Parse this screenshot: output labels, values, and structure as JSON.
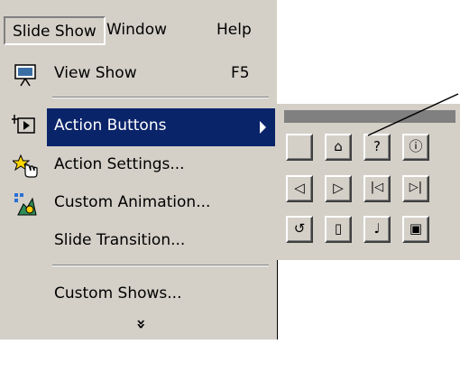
{
  "menubar": {
    "items": [
      {
        "label": "Slide Show",
        "active": true
      },
      {
        "label": "Window",
        "active": false
      },
      {
        "label": "Help",
        "active": false
      }
    ]
  },
  "menu": {
    "items": [
      {
        "label": "View Show",
        "shortcut": "F5",
        "icon": "projector-screen-icon"
      },
      {
        "label": "Action Buttons",
        "icon": "action-button-icon",
        "submenu": true,
        "highlighted": true
      },
      {
        "label": "Action Settings...",
        "icon": "star-hand-icon"
      },
      {
        "label": "Custom Animation...",
        "icon": "animation-icon"
      },
      {
        "label": "Slide Transition..."
      },
      {
        "label": "Custom Shows..."
      }
    ],
    "expand_glyph": "»"
  },
  "action_buttons": {
    "rows": [
      [
        {
          "name": "custom",
          "glyph": ""
        },
        {
          "name": "home",
          "glyph": "⌂"
        },
        {
          "name": "help",
          "glyph": "?"
        },
        {
          "name": "information",
          "glyph": "ⓘ"
        }
      ],
      [
        {
          "name": "back-previous",
          "glyph": "◁"
        },
        {
          "name": "forward-next",
          "glyph": "▷"
        },
        {
          "name": "beginning",
          "glyph": "|◁"
        },
        {
          "name": "end",
          "glyph": "▷|"
        }
      ],
      [
        {
          "name": "return",
          "glyph": "↺"
        },
        {
          "name": "document",
          "glyph": "▯"
        },
        {
          "name": "sound",
          "glyph": "♩"
        },
        {
          "name": "movie",
          "glyph": "▣"
        }
      ]
    ]
  },
  "colors": {
    "menu_bg": "#d4d0c8",
    "highlight": "#0a246a",
    "titlebar": "#808080"
  }
}
